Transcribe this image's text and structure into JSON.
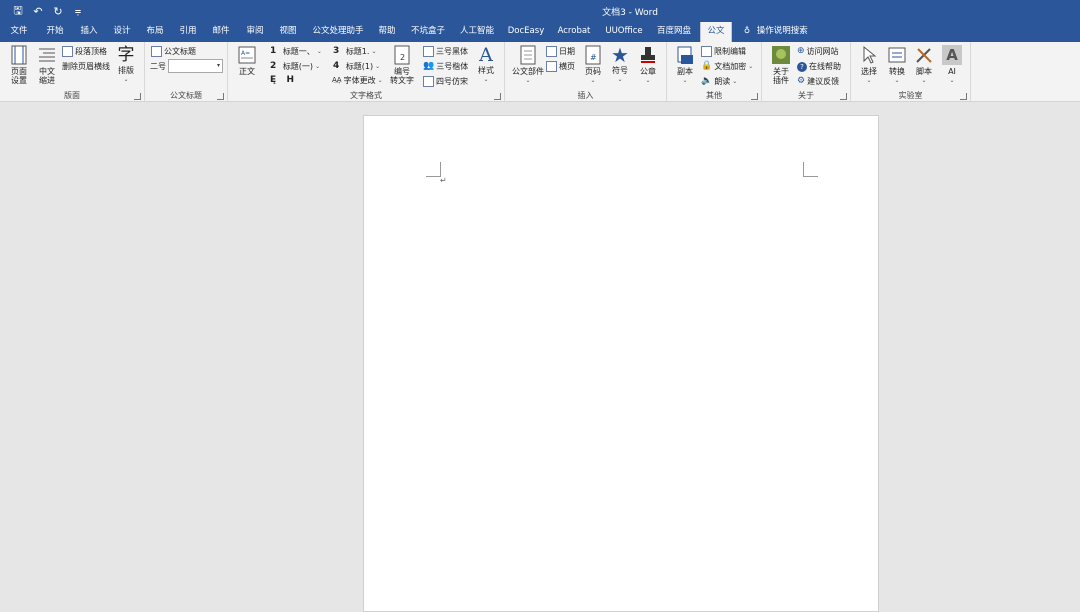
{
  "window": {
    "title": "文档3  -  Word",
    "qat": [
      {
        "name": "save-icon",
        "glyph": "🖫"
      },
      {
        "name": "undo-icon",
        "glyph": "↶"
      },
      {
        "name": "redo-icon",
        "glyph": "↻"
      },
      {
        "name": "customize-icon",
        "glyph": "⩦"
      }
    ]
  },
  "tabs": [
    "文件",
    "开始",
    "插入",
    "设计",
    "布局",
    "引用",
    "邮件",
    "审阅",
    "视图",
    "公文处理助手",
    "帮助",
    "不坑盒子",
    "人工智能",
    "DocEasy",
    "Acrobat",
    "UUOffice",
    "百度网盘",
    "公文"
  ],
  "tell_me": "操作说明搜索",
  "ribbon": {
    "layout": {
      "label": "版面",
      "page_setup": "页面\n设置",
      "indent": "中文\n缩进",
      "para_top": "段落顶格",
      "del_header_line": "删除页眉横线",
      "typeset": "排版",
      "typeset_glyph": "字"
    },
    "doc_title": {
      "label": "公文标题",
      "doc_title_btn": "公文标题",
      "size_label": "二号",
      "size_value": ""
    },
    "text_format": {
      "label": "文字格式",
      "body": "正文",
      "h1": "标题一、",
      "h2": "标题(一)",
      "h3": "标题1.",
      "h4": "标题(1)",
      "font_change": "字体更改",
      "number_convert": "编号\n转文字",
      "san_hei": "三号黑体",
      "san_kai": "三号楷体",
      "si_fang": "四号仿宋",
      "styles": "样式"
    },
    "insert": {
      "label": "插入",
      "doc_parts": "公文部件",
      "date": "日期",
      "landscape": "横页",
      "page_num": "页码",
      "symbol": "符号",
      "seal": "公章"
    },
    "other": {
      "label": "其他",
      "copy": "副本",
      "restrict": "限制编辑",
      "encrypt": "文档加密",
      "read_aloud": "朗读"
    },
    "about": {
      "label": "关于",
      "about_plugin": "关于\n插件",
      "visit_site": "访问网站",
      "online_help": "在线帮助",
      "feedback": "建议反馈"
    },
    "lab": {
      "label": "实验室",
      "select": "选择",
      "convert": "转换",
      "script": "脚本",
      "ai": "AI"
    }
  },
  "document": {
    "paragraph_mark": "↵"
  },
  "colors": {
    "accent": "#2b579a",
    "ribbon_bg": "#f3f3f3",
    "canvas_bg": "#e6e6e6"
  }
}
